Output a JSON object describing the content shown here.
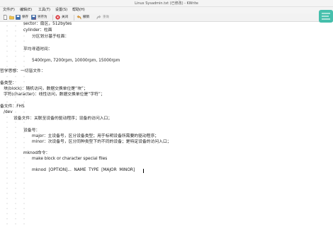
{
  "window": {
    "title": "Linux Sysadmin.txt (已修改) - KWrite"
  },
  "menu": {
    "file": "文件(F)",
    "edit": "编辑(E)",
    "tools": "工具(T)",
    "settings": "设置(S)",
    "help": "帮助(H)"
  },
  "toolbar": {
    "new": "新建",
    "open": "打开",
    "save": "保存",
    "save_as": "另存为",
    "close": "关闭",
    "undo": "撤销",
    "redo": "重做"
  },
  "editor": {
    "lines": [
      "sector：扇区，512bytes",
      "cylinder：柱面",
      "分区划分基于柱面：",
      "平均寻道时间：",
      "5400rpm, 7200rpm, 10000rpm, 15000rpm",
      "哲学思想：一切皆文件：",
      "备类型：",
      "块(block)：随机访问，数据交换单位是“块”；",
      "字符(character)：线性访问，数据交换单位是“字符”；",
      "备文件：FHS",
      "/dev",
      "设备文件：关联至设备的驱动程序；设备的访问入口；",
      "设备号：",
      "major：主设备号，区分设备类型；用于标明设备所需要的驱动程序；",
      "minor：次设备号，区分同种类型下的不同的设备；是特定设备的访问入口；",
      "mknod命令：",
      "make block or character special files",
      "mknod  [OPTION]...  NAME  TYPE  [MAJOR  MINOR]"
    ]
  },
  "colors": {
    "close_icon": "#d8242b",
    "undo_icon": "#e8a33d",
    "watermark": "#28b6a0"
  }
}
